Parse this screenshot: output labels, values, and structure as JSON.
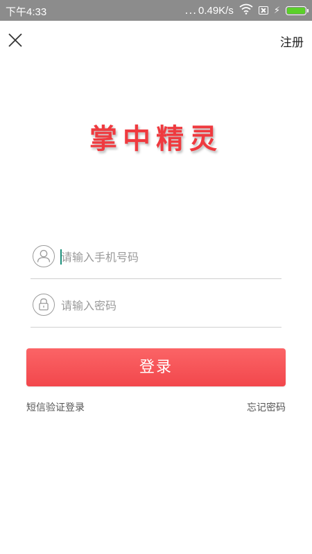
{
  "status_bar": {
    "time": "下午4:33",
    "dots": "...",
    "network_speed": "0.49K/s",
    "icons": [
      "wifi-icon",
      "sim-icon",
      "charging-icon",
      "battery-icon"
    ],
    "battery_color": "#5bd02a",
    "background": "#8c8c8c"
  },
  "header": {
    "close_icon": "close-icon",
    "register_label": "注册"
  },
  "logo": {
    "text": "掌中精灵",
    "color": "#ef3a3f"
  },
  "form": {
    "phone": {
      "icon": "user-icon",
      "placeholder": "请输入手机号码",
      "value": ""
    },
    "password": {
      "icon": "lock-icon",
      "placeholder": "请输入密码",
      "value": ""
    },
    "login_label": "登录",
    "login_color": "#f2474c"
  },
  "links": {
    "sms_login": "短信验证登录",
    "forgot_password": "忘记密码"
  }
}
